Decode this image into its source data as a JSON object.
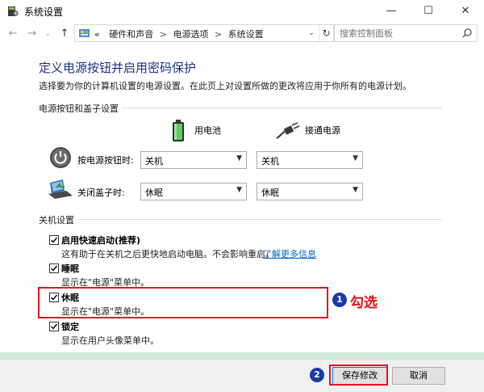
{
  "window": {
    "title": "系统设置",
    "controls": {
      "minimize": "—",
      "maximize": "☐",
      "close": "✕"
    }
  },
  "nav": {
    "back": "←",
    "forward": "→",
    "recent": "⌄",
    "up": "↑",
    "breadcrumb_lead": "«",
    "breadcrumb": [
      "硬件和声音",
      "电源选项",
      "系统设置"
    ],
    "separator": ">",
    "dropdown": "⌄",
    "refresh": "↻",
    "search_placeholder": "搜索控制面板"
  },
  "page": {
    "title": "定义电源按钮并启用密码保护",
    "description": "选择要为你的计算机设置的电源设置。在此页上对设置所做的更改将应用于你所有的电源计划。"
  },
  "power_section": {
    "header": "电源按钮和盖子设置",
    "battery_label": "用电池",
    "plugged_label": "接通电源",
    "power_button_label": "按电源按钮时:",
    "lid_label": "关闭盖子时:",
    "power_button_battery": "关机",
    "power_button_plugged": "关机",
    "lid_battery": "休眠",
    "lid_plugged": "休眠"
  },
  "shutdown_section": {
    "header": "关机设置",
    "options": [
      {
        "label": "启用快速启动(推荐)",
        "desc": "这有助于在关机之后更快地启动电脑。不会影响重启。",
        "link": "了解更多信息",
        "checked": true
      },
      {
        "label": "睡眠",
        "desc": "显示在\"电源\"菜单中。",
        "checked": true
      },
      {
        "label": "休眠",
        "desc": "显示在\"电源\"菜单中。",
        "checked": true
      },
      {
        "label": "锁定",
        "desc": "显示在用户头像菜单中。",
        "checked": true
      }
    ]
  },
  "annotations": {
    "step1_number": "1",
    "step1_text": "勾选",
    "step2_number": "2"
  },
  "footer": {
    "save": "保存修改",
    "cancel": "取消"
  },
  "colors": {
    "title_blue": "#1e3287",
    "link_blue": "#0066cc",
    "highlight_red": "#e8101a",
    "badge_blue": "#1a3aa8"
  }
}
